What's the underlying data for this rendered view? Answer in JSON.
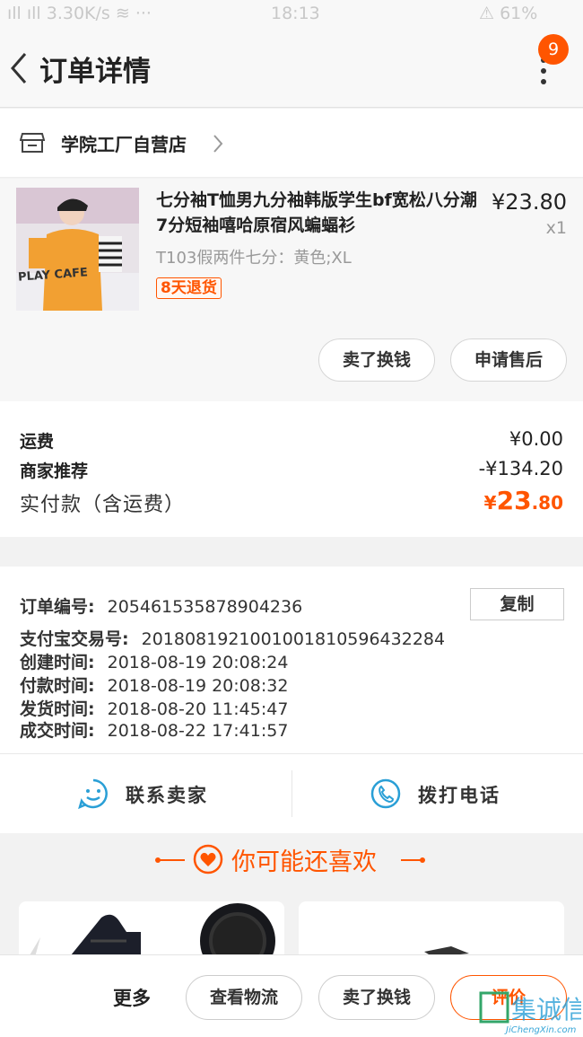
{
  "status_bar": {
    "carrier": "ıll ıll 3.30K/s ≋ ···",
    "time": "18:13",
    "battery": "⚠ 61%"
  },
  "nav": {
    "title": "订单详情",
    "badge": "9"
  },
  "shop": {
    "name": "学院工厂自营店"
  },
  "product": {
    "title": "七分袖T恤男九分袖韩版学生bf宽松八分潮7分短袖嘻哈原宿风蝙蝠衫",
    "price": "¥23.80",
    "qty": "x1",
    "sku": "T103假两件七分：黄色;XL",
    "return_tag": "8天退货",
    "image_text": "PLAY CAFE",
    "actions": [
      "卖了换钱",
      "申请售后"
    ]
  },
  "fees": {
    "shipping_label": "运费",
    "shipping_value": "¥0.00",
    "discount_label": "商家推荐",
    "discount_value": "-¥134.20",
    "paid_label": "实付款（含运费）",
    "paid_currency": "¥",
    "paid_int": "23",
    "paid_dec": ".80"
  },
  "order_info": {
    "copy_label": "复制",
    "lines": [
      {
        "label": "订单编号:",
        "value": "205461535878904236"
      },
      {
        "label": "支付宝交易号:",
        "value": "2018081921001001810596432284"
      },
      {
        "label": "创建时间:",
        "value": "2018-08-19 20:08:24"
      },
      {
        "label": "付款时间:",
        "value": "2018-08-19 20:08:32"
      },
      {
        "label": "发货时间:",
        "value": "2018-08-20 11:45:47"
      },
      {
        "label": "成交时间:",
        "value": "2018-08-22 17:41:57"
      }
    ]
  },
  "contact": {
    "seller": "联系卖家",
    "phone": "拨打电话"
  },
  "recommend": {
    "title": "你可能还喜欢"
  },
  "bottom_bar": {
    "more": "更多",
    "logistics": "查看物流",
    "sell": "卖了换钱",
    "review": "评价"
  },
  "watermark": {
    "text": "JiChengXin.com",
    "glyphs": "集诚信"
  },
  "colors": {
    "accent": "#ff5500",
    "icon_blue": "#2a9fd6"
  }
}
